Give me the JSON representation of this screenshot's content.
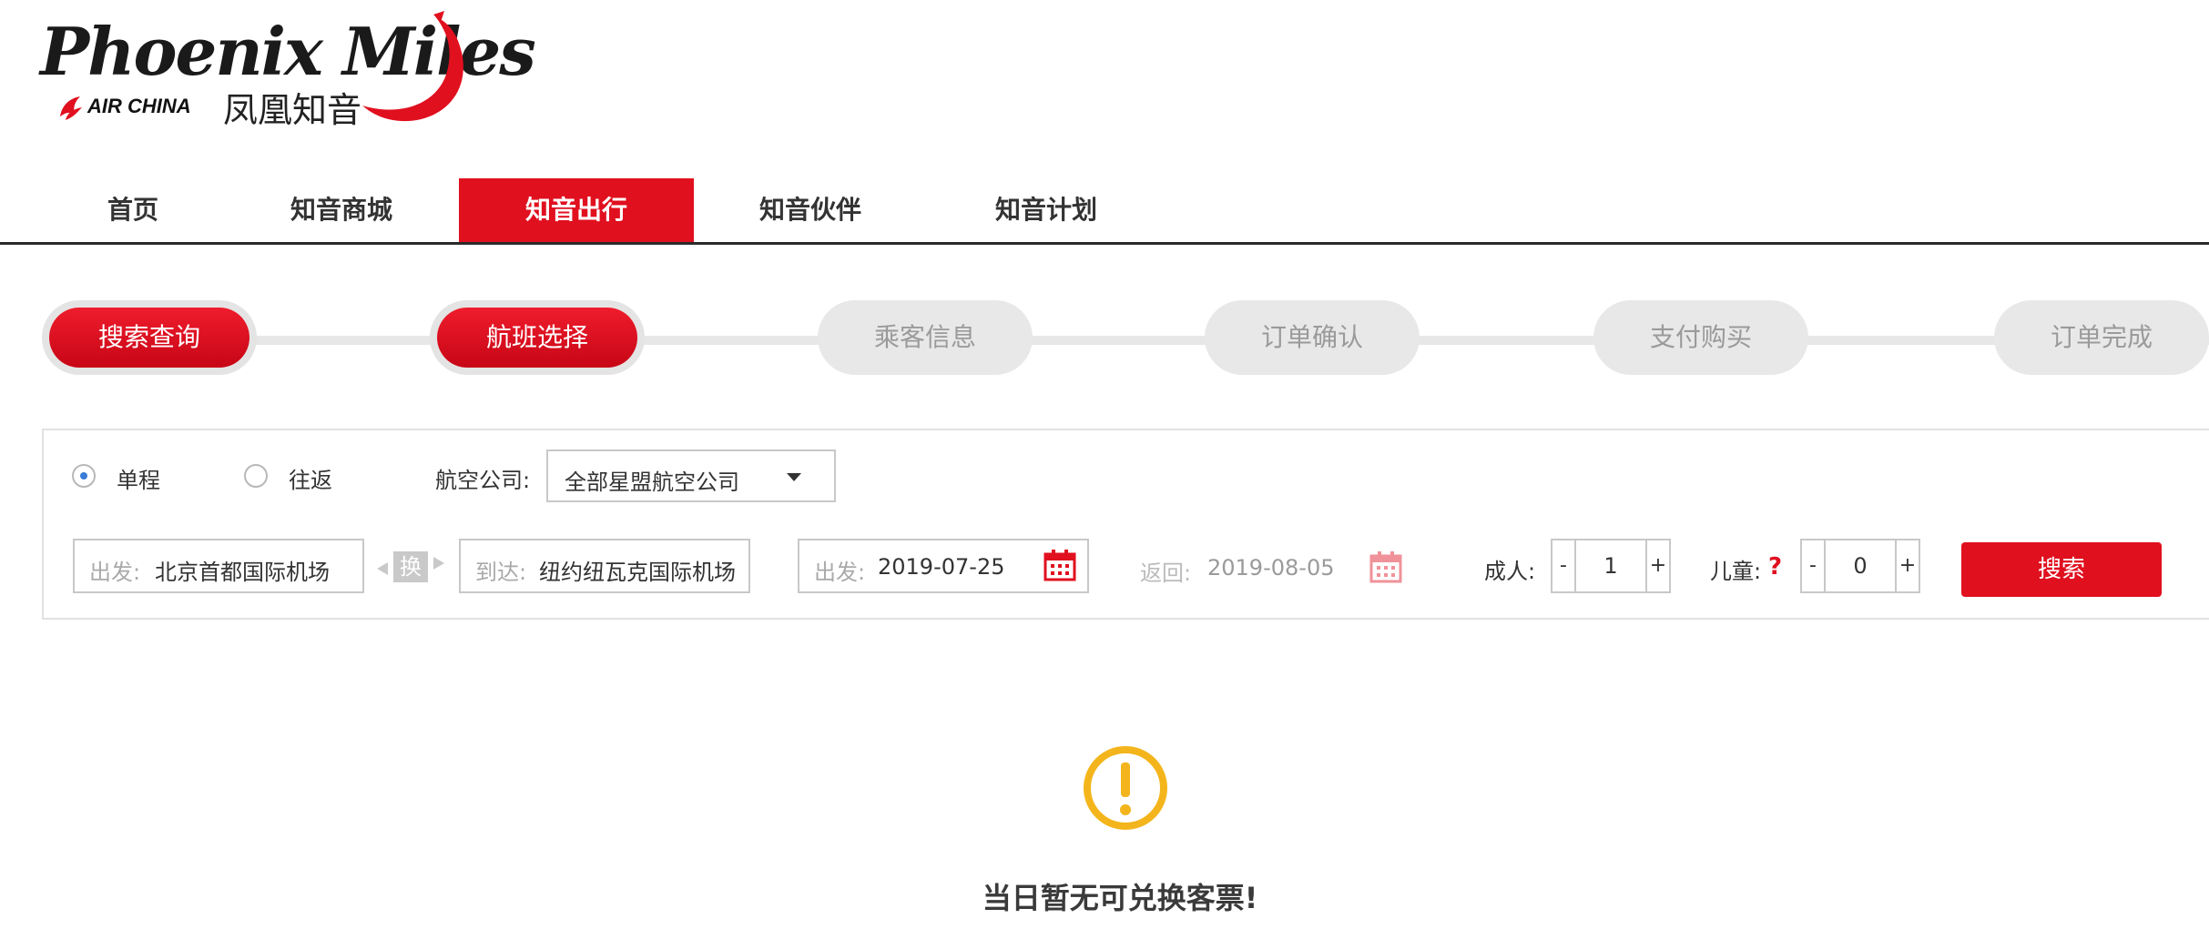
{
  "logo": {
    "script_text": "Phoenix Miles",
    "airline_text": "AIR CHINA",
    "chinese_text": "凤凰知音"
  },
  "nav": {
    "items": [
      {
        "label": "首页",
        "active": false
      },
      {
        "label": "知音商城",
        "active": false
      },
      {
        "label": "知音出行",
        "active": true
      },
      {
        "label": "知音伙伴",
        "active": false
      },
      {
        "label": "知音计划",
        "active": false
      }
    ]
  },
  "steps": [
    {
      "label": "搜索查询",
      "done": true
    },
    {
      "label": "航班选择",
      "done": true
    },
    {
      "label": "乘客信息",
      "done": false
    },
    {
      "label": "订单确认",
      "done": false
    },
    {
      "label": "支付购买",
      "done": false
    },
    {
      "label": "订单完成",
      "done": false
    }
  ],
  "search": {
    "trip_types": [
      {
        "label": "单程",
        "checked": true
      },
      {
        "label": "往返",
        "checked": false
      }
    ],
    "airline_label": "航空公司:",
    "airline_value": "全部星盟航空公司",
    "from_prefix": "出发:",
    "from_value": "北京首都国际机场",
    "swap_label": "换",
    "to_prefix": "到达:",
    "to_value": "纽约纽瓦克国际机场",
    "depart_prefix": "出发:",
    "depart_value": "2019-07-25",
    "return_prefix": "返回:",
    "return_value": "2019-08-05",
    "adult_label": "成人:",
    "adult_count": "1",
    "child_label": "儿童:",
    "child_help": "?",
    "child_count": "0",
    "minus": "-",
    "plus": "+",
    "search_button": "搜索"
  },
  "empty_state": {
    "message": "当日暂无可兑换客票!"
  },
  "colors": {
    "brand_red": "#e0101f",
    "warning_yellow": "#f3b51b"
  }
}
